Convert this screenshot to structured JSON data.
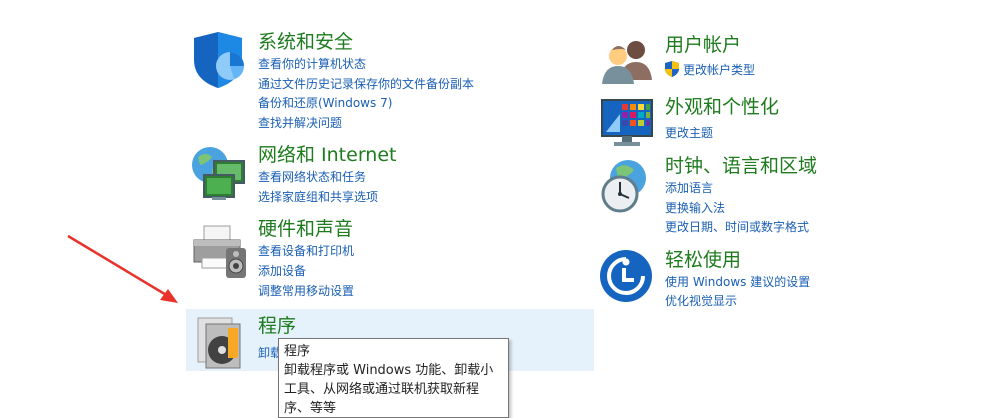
{
  "categories": {
    "system": {
      "title": "系统和安全",
      "links": [
        "查看你的计算机状态",
        "通过文件历史记录保存你的文件备份副本",
        "备份和还原(Windows 7)",
        "查找并解决问题"
      ]
    },
    "network": {
      "title": "网络和 Internet",
      "links": [
        "查看网络状态和任务",
        "选择家庭组和共享选项"
      ]
    },
    "hardware": {
      "title": "硬件和声音",
      "links": [
        "查看设备和打印机",
        "添加设备",
        "调整常用移动设置"
      ]
    },
    "programs": {
      "title": "程序",
      "links": [
        "卸载"
      ]
    },
    "accounts": {
      "title": "用户帐户",
      "links": [
        "更改帐户类型"
      ]
    },
    "appearance": {
      "title": "外观和个性化",
      "links": [
        "更改主题"
      ]
    },
    "clock": {
      "title": "时钟、语言和区域",
      "links": [
        "添加语言",
        "更换输入法",
        "更改日期、时间或数字格式"
      ]
    },
    "ease": {
      "title": "轻松使用",
      "links": [
        "使用 Windows 建议的设置",
        "优化视觉显示"
      ]
    }
  },
  "tooltip": {
    "title": "程序",
    "body": "卸载程序或 Windows 功能、卸载小工具、从网络或通过联机获取新程序、等等"
  },
  "colors": {
    "title_green": "#1e7b1e",
    "link_blue": "#1a5fb4",
    "highlight": "#e5f1fb",
    "arrow_red": "#e8322b"
  }
}
